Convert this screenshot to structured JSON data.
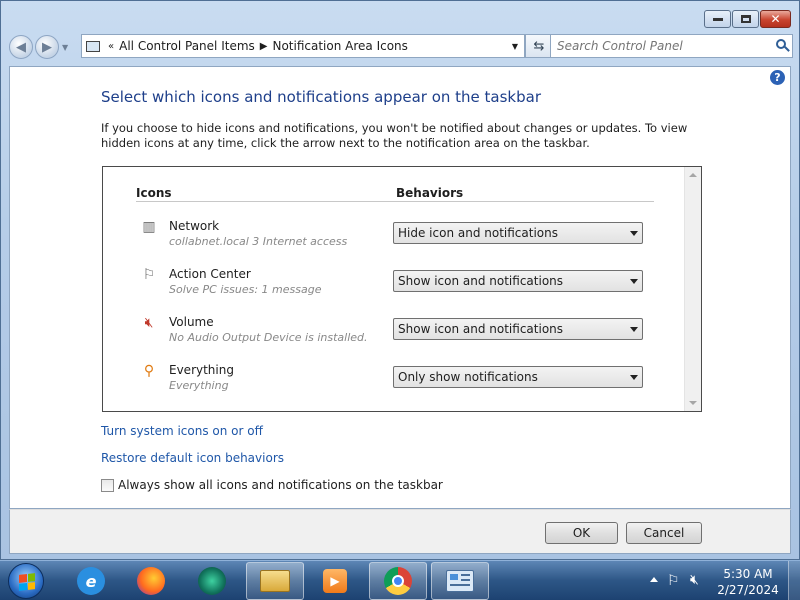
{
  "window": {
    "minimize_icon": "minimize-icon",
    "maximize_icon": "maximize-icon",
    "close_icon": "close-icon"
  },
  "address": {
    "segments": [
      "All Control Panel Items",
      "Notification Area Icons"
    ]
  },
  "search": {
    "placeholder": "Search Control Panel"
  },
  "main": {
    "heading": "Select which icons and notifications appear on the taskbar",
    "description": "If you choose to hide icons and notifications, you won't be notified about changes or updates. To view hidden icons at any time, click the arrow next to the notification area on the taskbar.",
    "columns": {
      "icons": "Icons",
      "behaviors": "Behaviors"
    },
    "rows": [
      {
        "name": "Network",
        "sub": "collabnet.local  3 Internet access",
        "behavior": "Hide icon and notifications",
        "icon": "network-icon"
      },
      {
        "name": "Action Center",
        "sub": "Solve PC issues: 1 message",
        "behavior": "Show icon and notifications",
        "icon": "flag-icon"
      },
      {
        "name": "Volume",
        "sub": "No Audio Output Device is installed.",
        "behavior": "Show icon and notifications",
        "icon": "volume-muted-icon"
      },
      {
        "name": "Everything",
        "sub": "Everything",
        "behavior": "Only show notifications",
        "icon": "magnifier-icon"
      }
    ],
    "links": {
      "system_icons": "Turn system icons on or off",
      "restore": "Restore default icon behaviors"
    },
    "always_show": "Always show all icons and notifications on the taskbar"
  },
  "footer": {
    "ok": "OK",
    "cancel": "Cancel"
  },
  "taskbar": {
    "apps": [
      "internet-explorer-icon",
      "firefox-icon",
      "app-icon",
      "file-explorer-icon",
      "media-player-icon",
      "chrome-icon",
      "control-panel-icon"
    ],
    "time": "5:30 AM",
    "date": "2/27/2024"
  }
}
